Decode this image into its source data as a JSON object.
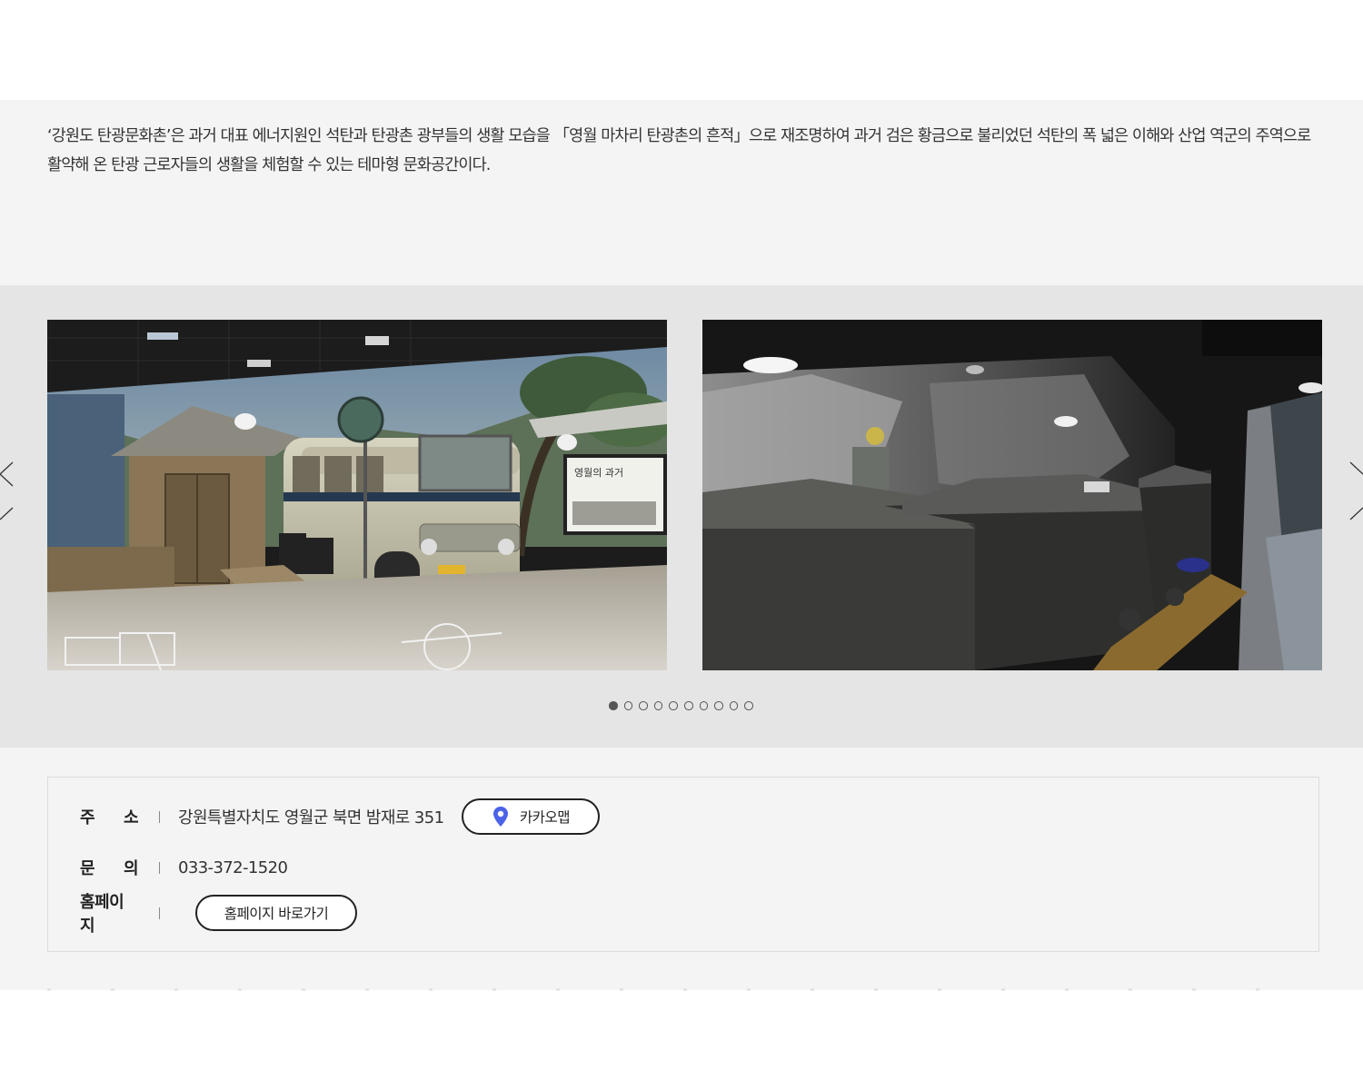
{
  "intro": {
    "text": "‘강원도 탄광문화촌’은 과거 대표 에너지원인 석탄과 탄광촌 광부들의 생활 모습을 「영월 마차리 탄광촌의 흔적」으로 재조명하여 과거 검은 황금으로 불리었던 석탄의 폭 넓은 이해와 산업 역군의 주역으로 활약해 온 탄광 근로자들의 생활을 체험할 수 있는 테마형 문화공간이다."
  },
  "gallery": {
    "slides": [
      {
        "name": "bus-stop-exhibit",
        "sign_text": "영월의 과거"
      },
      {
        "name": "coal-mine-cart-exhibit"
      }
    ],
    "dot_count": 10,
    "active_dot": 0
  },
  "info": {
    "address": {
      "label": "주 소",
      "label_chars": [
        "주",
        "소"
      ],
      "value": "강원특별자치도 영월군 북면 밤재로 351",
      "map_button": "카카오맵"
    },
    "contact": {
      "label": "문 의",
      "label_chars": [
        "문",
        "의"
      ],
      "value": "033-372-1520"
    },
    "homepage": {
      "label": "홈페이지",
      "button": "홈페이지 바로가기"
    }
  },
  "colors": {
    "intro_bg": "#f4f4f4",
    "gallery_bg": "#e5e5e5",
    "map_pin": "#4a63e8"
  }
}
